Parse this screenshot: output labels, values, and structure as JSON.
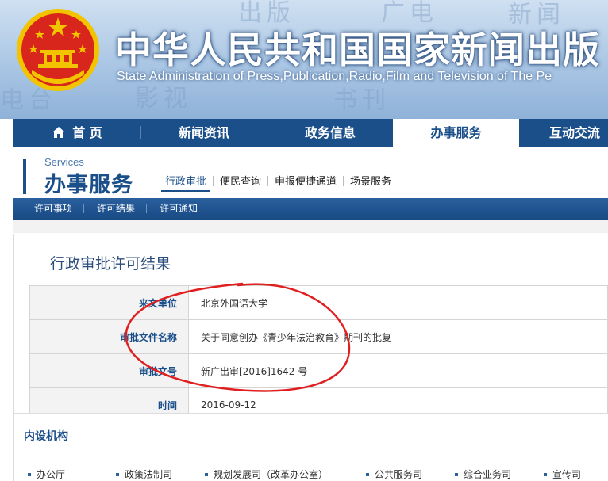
{
  "header": {
    "title_cn": "中华人民共和国国家新闻出版",
    "title_en": "State Administration of Press,Publication,Radio,Film and Television of The Pe",
    "background_chars": [
      "出版",
      "广电",
      "新闻",
      "影视",
      "书刊",
      "电台"
    ]
  },
  "main_nav": {
    "items": [
      {
        "label": "首 页",
        "icon": "home-icon"
      },
      {
        "label": "新闻资讯"
      },
      {
        "label": "政务信息"
      },
      {
        "label": "办事服务",
        "active": true
      },
      {
        "label": "互动交流"
      }
    ]
  },
  "services": {
    "label_en": "Services",
    "label_cn": "办事服务",
    "subtabs": [
      "行政审批",
      "便民查询",
      "申报便捷通道",
      "场景服务"
    ],
    "subnav": [
      "许可事项",
      "许可结果",
      "许可通知"
    ]
  },
  "content": {
    "page_title": "行政审批许可结果",
    "rows": [
      {
        "label": "来文单位",
        "value": "北京外国语大学"
      },
      {
        "label": "审批文件名称",
        "value": "关于同意创办《青少年法治教育》期刊的批复"
      },
      {
        "label": "审批文号",
        "value": "新广出审[2016]1642 号"
      },
      {
        "label": "时间",
        "value": "2016-09-12"
      }
    ]
  },
  "org": {
    "title": "内设机构",
    "items": [
      "办公厅",
      "政策法制司",
      "规划发展司（改革办公室）",
      "公共服务司",
      "综合业务司",
      "宣传司"
    ]
  },
  "colors": {
    "nav_blue": "#1b4f8a",
    "annotation_red": "#e02020",
    "emblem_red": "#d9261c",
    "emblem_gold": "#f2c400"
  }
}
